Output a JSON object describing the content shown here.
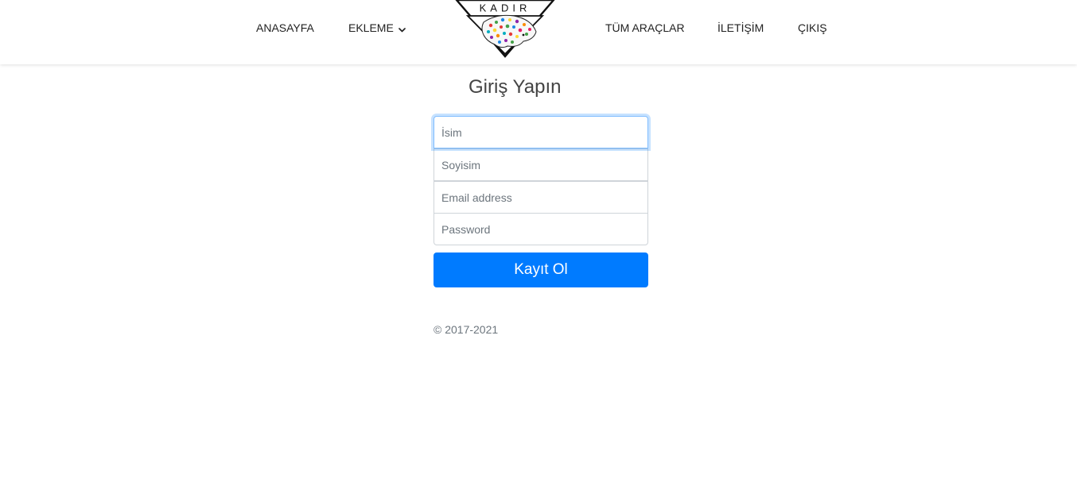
{
  "nav": {
    "items": [
      {
        "label": "ANASAYFA"
      },
      {
        "label": "EKLEME"
      },
      {
        "label": "TÜM ARAÇLAR"
      },
      {
        "label": "İLETİŞİM"
      },
      {
        "label": "ÇIKIŞ"
      }
    ],
    "logo_text": "KADIR"
  },
  "form": {
    "title": "Giriş Yapın",
    "fields": [
      {
        "placeholder": "İsim",
        "value": ""
      },
      {
        "placeholder": "Soyisim",
        "value": ""
      },
      {
        "placeholder": "Email address",
        "value": ""
      },
      {
        "placeholder": "Password",
        "value": ""
      }
    ],
    "submit_label": "Kayıt Ol"
  },
  "footer": {
    "copyright": "© 2017-2021"
  },
  "colors": {
    "primary": "#007bff",
    "focus_border": "#80bdff",
    "text": "#222222",
    "muted": "#6c757d"
  },
  "icons": {
    "dropdown": "chevron-down-icon",
    "logo": "leopard-triangle-logo"
  }
}
